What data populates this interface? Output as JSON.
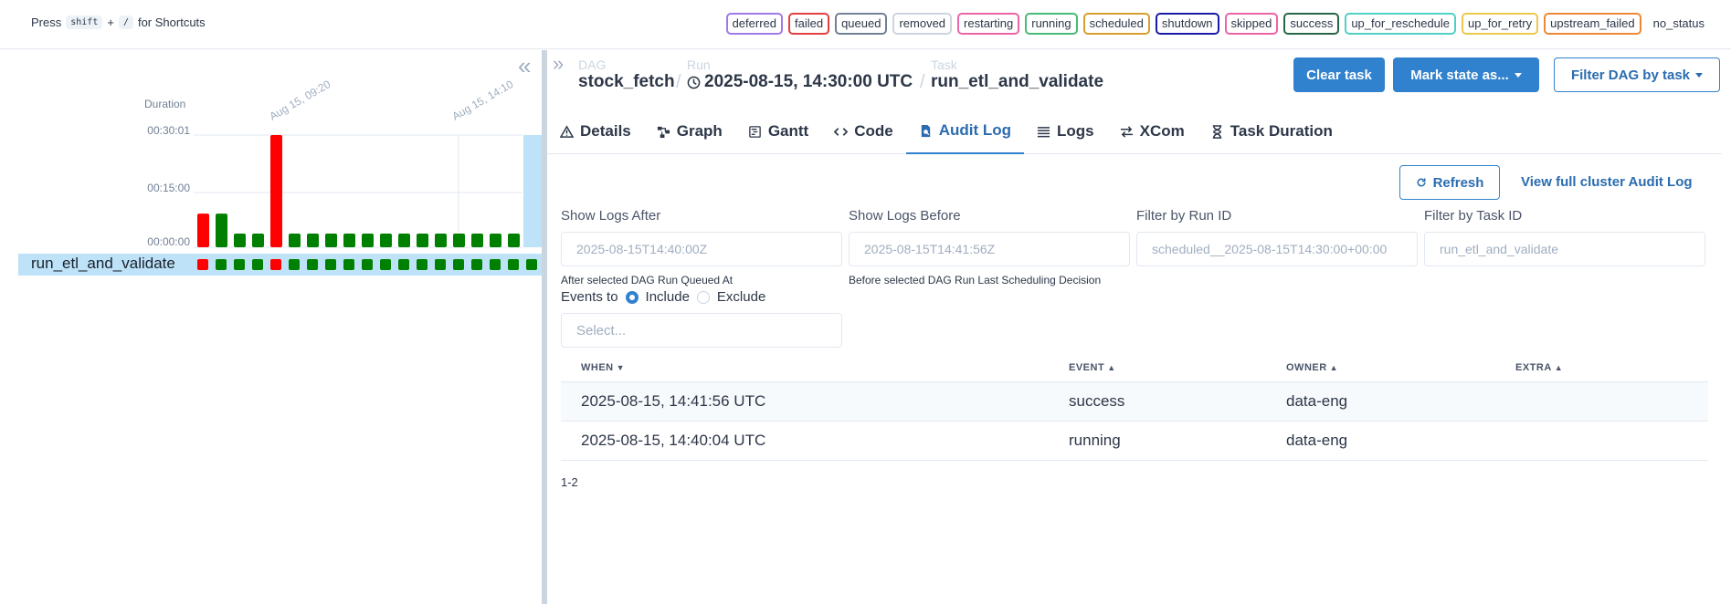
{
  "shortcut_hint": {
    "prefix": "Press",
    "key1": "shift",
    "plus": "+",
    "key2": "/",
    "suffix": "for Shortcuts"
  },
  "legend": [
    {
      "label": "deferred",
      "color": "#9f7aea"
    },
    {
      "label": "failed",
      "color": "#e53e3e"
    },
    {
      "label": "queued",
      "color": "#718096"
    },
    {
      "label": "removed",
      "color": "#cbd5e0"
    },
    {
      "label": "restarting",
      "color": "#ed64a6"
    },
    {
      "label": "running",
      "color": "#48bb78"
    },
    {
      "label": "scheduled",
      "color": "#d69e2e"
    },
    {
      "label": "shutdown",
      "color": "#1a1aa6"
    },
    {
      "label": "skipped",
      "color": "#ed64a6"
    },
    {
      "label": "success",
      "color": "#276749"
    },
    {
      "label": "up_for_reschedule",
      "color": "#4fd1c5"
    },
    {
      "label": "up_for_retry",
      "color": "#ecc94b"
    },
    {
      "label": "upstream_failed",
      "color": "#ed8936"
    },
    {
      "label": "no_status",
      "color": ""
    }
  ],
  "grid": {
    "duration_label": "Duration",
    "y_ticks": [
      "00:30:01",
      "00:15:00",
      "00:00:00"
    ],
    "date_labels": [
      "Aug 15, 09:20",
      "Aug 15, 14:10"
    ],
    "task_name": "run_etl_and_validate"
  },
  "chart_data": {
    "type": "bar",
    "ylabel": "Duration",
    "y_tick_labels": [
      "00:00:00",
      "00:15:00",
      "00:30:01"
    ],
    "ylim_seconds": [
      0,
      1801
    ],
    "values_seconds": [
      540,
      540,
      220,
      220,
      1801,
      220,
      220,
      220,
      220,
      220,
      220,
      220,
      220,
      220,
      220,
      220,
      220,
      220,
      1801
    ],
    "states": [
      "failed",
      "success",
      "success",
      "success",
      "failed",
      "success",
      "success",
      "success",
      "success",
      "success",
      "success",
      "success",
      "success",
      "success",
      "success",
      "success",
      "success",
      "success",
      "selected"
    ],
    "status_colors": {
      "success": "#008000",
      "failed": "#ff0000",
      "selected": "#bee3f8"
    }
  },
  "breadcrumb": {
    "dag_label": "DAG",
    "dag_value": "stock_fetch",
    "run_label": "Run",
    "run_value": "2025-08-15, 14:30:00 UTC",
    "task_label": "Task",
    "task_value": "run_etl_and_validate",
    "separator": "/"
  },
  "actions": {
    "clear_task": "Clear task",
    "mark_state": "Mark state as...",
    "filter_dag": "Filter DAG by task"
  },
  "tabs": [
    {
      "label": "Details",
      "icon": "warning-triangle-icon"
    },
    {
      "label": "Graph",
      "icon": "graph-icon"
    },
    {
      "label": "Gantt",
      "icon": "gantt-icon"
    },
    {
      "label": "Code",
      "icon": "code-icon"
    },
    {
      "label": "Audit Log",
      "icon": "document-icon",
      "active": true
    },
    {
      "label": "Logs",
      "icon": "list-icon"
    },
    {
      "label": "XCom",
      "icon": "exchange-icon"
    },
    {
      "label": "Task Duration",
      "icon": "hourglass-icon"
    }
  ],
  "audit": {
    "refresh_label": "Refresh",
    "full_log_link": "View full cluster Audit Log",
    "filters": {
      "after_label": "Show Logs After",
      "after_value": "2025-08-15T14:40:00Z",
      "after_help": "After selected DAG Run Queued At",
      "before_label": "Show Logs Before",
      "before_value": "2025-08-15T14:41:56Z",
      "before_help": "Before selected DAG Run Last Scheduling Decision",
      "run_label": "Filter by Run ID",
      "run_value": "scheduled__2025-08-15T14:30:00+00:00",
      "task_label": "Filter by Task ID",
      "task_value": "run_etl_and_validate"
    },
    "events_to_label": "Events to",
    "include_label": "Include",
    "exclude_label": "Exclude",
    "select_placeholder": "Select...",
    "columns": {
      "when": "WHEN",
      "event": "EVENT",
      "owner": "OWNER",
      "extra": "EXTRA"
    },
    "rows": [
      {
        "when": "2025-08-15, 14:41:56 UTC",
        "event": "success",
        "owner": "data-eng",
        "extra": ""
      },
      {
        "when": "2025-08-15, 14:40:04 UTC",
        "event": "running",
        "owner": "data-eng",
        "extra": ""
      }
    ],
    "pagination": "1-2"
  }
}
